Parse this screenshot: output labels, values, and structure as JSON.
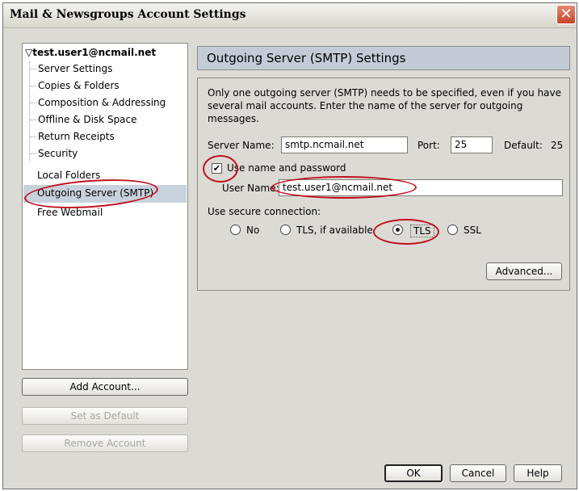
{
  "window": {
    "title": "Mail & Newsgroups Account Settings"
  },
  "tree": {
    "account": "▽test.user1@ncmail.net",
    "children": [
      "Server Settings",
      "Copies & Folders",
      "Composition & Addressing",
      "Offline & Disk Space",
      "Return Receipts",
      "Security"
    ],
    "others": [
      "Local Folders",
      "Outgoing Server (SMTP)",
      "Free Webmail"
    ],
    "selected": "Outgoing Server (SMTP)"
  },
  "left_buttons": {
    "add": "Add Account...",
    "default": "Set as Default",
    "remove": "Remove Account"
  },
  "panel": {
    "title": "Outgoing Server (SMTP) Settings",
    "description": "Only one outgoing server (SMTP) needs to be specified, even if you have several mail accounts. Enter the name of the server for outgoing messages.",
    "server_label": "Server Name:",
    "server_value": "smtp.ncmail.net",
    "port_label": "Port:",
    "port_value": "25",
    "default_label": "Default:",
    "default_value": "25",
    "use_auth_label": "Use name and password",
    "use_auth_checked": true,
    "username_label": "User Name:",
    "username_value": "test.user1@ncmail.net",
    "secure_label": "Use secure connection:",
    "secure_options": [
      "No",
      "TLS, if available",
      "TLS",
      "SSL"
    ],
    "secure_selected": "TLS",
    "advanced_label": "Advanced..."
  },
  "footer": {
    "ok": "OK",
    "cancel": "Cancel",
    "help": "Help"
  },
  "colors": {
    "annotation": "#c0101c",
    "selection": "#c8d2dc",
    "panel_header": "#c3ccd6"
  }
}
